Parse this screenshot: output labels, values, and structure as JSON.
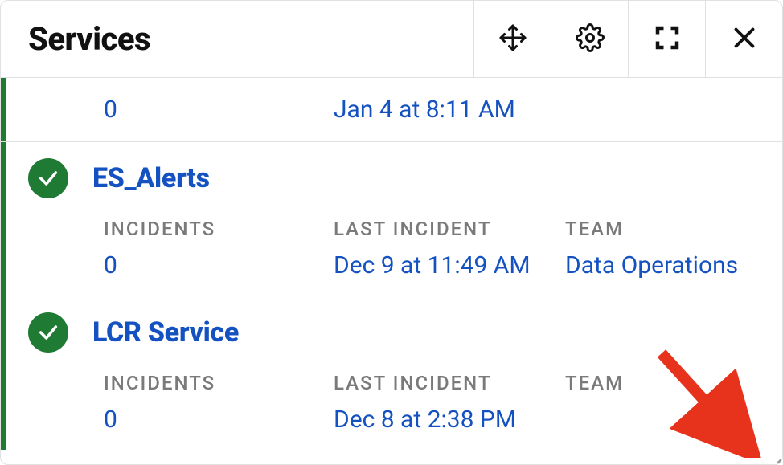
{
  "header": {
    "title": "Services"
  },
  "labels": {
    "incidents": "Incidents",
    "last_incident": "Last Incident",
    "team": "Team"
  },
  "rows": [
    {
      "partial": true,
      "incidents": "0",
      "last_incident": "Jan 4 at 8:11 AM",
      "team": ""
    },
    {
      "name": "ES_Alerts",
      "incidents": "0",
      "last_incident": "Dec 9 at 11:49 AM",
      "team": "Data Operations"
    },
    {
      "name": "LCR Service",
      "incidents": "0",
      "last_incident": "Dec 8 at 2:38 PM",
      "team": ""
    }
  ]
}
